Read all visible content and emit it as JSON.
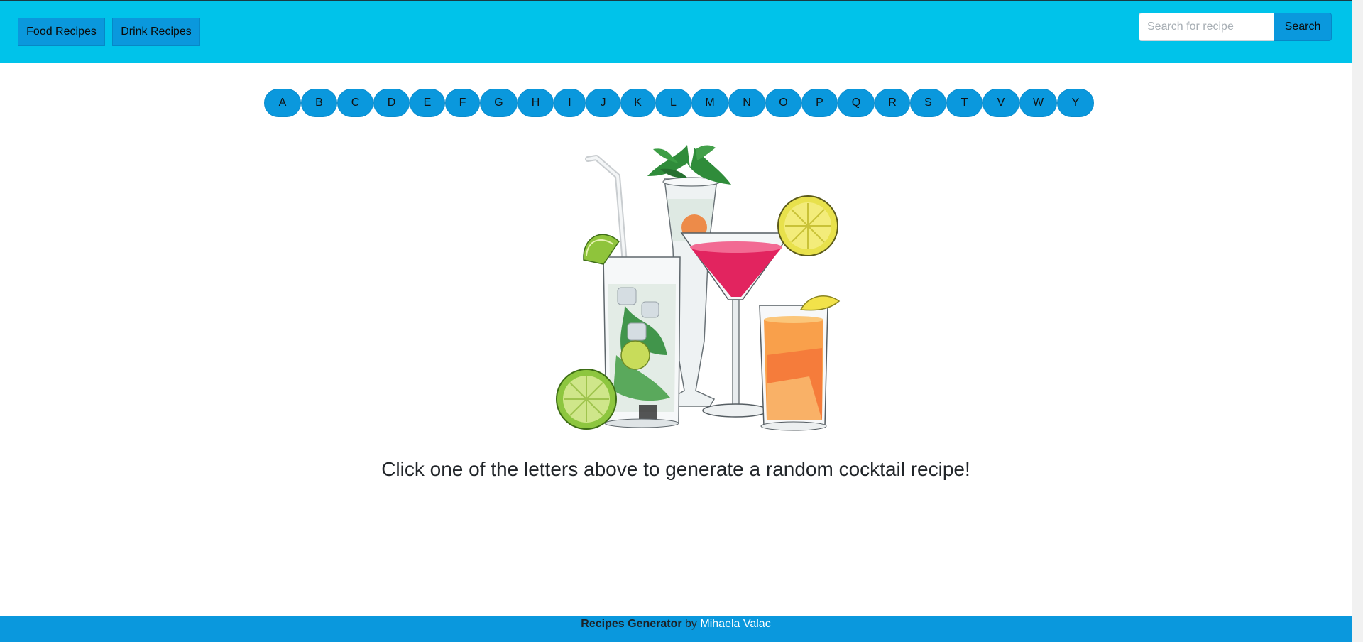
{
  "navbar": {
    "food_label": "Food Recipes",
    "drink_label": "Drink Recipes",
    "search_placeholder": "Search for recipe",
    "search_value": "",
    "search_button": "Search"
  },
  "letters": [
    "A",
    "B",
    "C",
    "D",
    "E",
    "F",
    "G",
    "H",
    "I",
    "J",
    "K",
    "L",
    "M",
    "N",
    "O",
    "P",
    "Q",
    "R",
    "S",
    "T",
    "V",
    "W",
    "Y"
  ],
  "hero": {
    "image_icon": "cocktails-watercolor-illustration"
  },
  "main": {
    "tagline": "Click one of the letters above to generate a random cocktail recipe!"
  },
  "footer": {
    "brand": "Recipes Generator",
    "by": "by",
    "author": "Mihaela Valac"
  },
  "colors": {
    "navbar": "#00c3ea",
    "button": "#0a98dd",
    "footer": "#0a98dd"
  }
}
